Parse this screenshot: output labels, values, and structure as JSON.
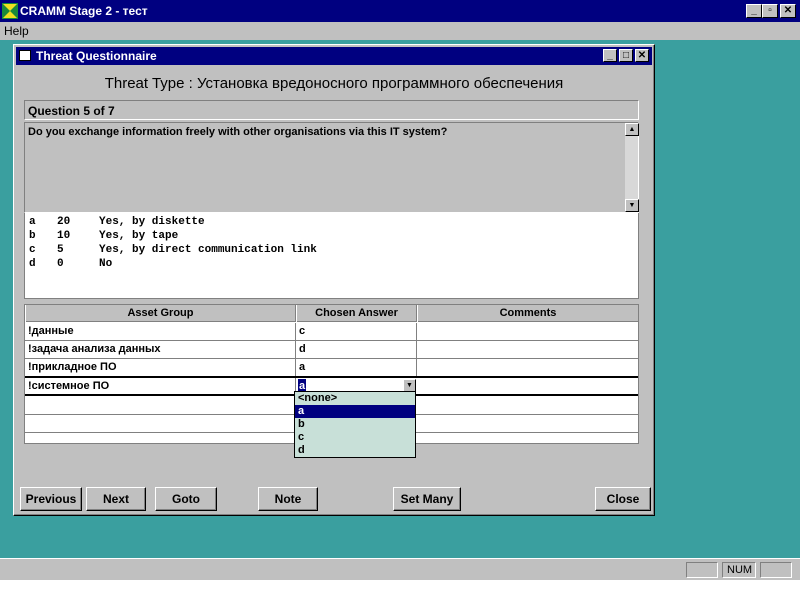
{
  "app": {
    "title": "CRAMM Stage 2 - тест",
    "menu": [
      "Help"
    ],
    "status": {
      "num": "NUM"
    }
  },
  "dialog": {
    "title": "Threat Questionnaire",
    "threat_type": "Threat Type : Установка вредоносного программного обеспечения",
    "question_header": "Question 5 of 7",
    "question_text": "Do you exchange information freely with other organisations via this IT system?",
    "answers": [
      {
        "letter": "a",
        "score": "20",
        "text": "Yes, by diskette"
      },
      {
        "letter": "b",
        "score": "10",
        "text": "Yes, by tape"
      },
      {
        "letter": "c",
        "score": "5",
        "text": "Yes, by direct communication link"
      },
      {
        "letter": "d",
        "score": "0",
        "text": "No"
      }
    ],
    "grid": {
      "columns": [
        "Asset Group",
        "Chosen Answer",
        "Comments"
      ],
      "rows": [
        {
          "group": "!данные",
          "answer": "c",
          "comment": ""
        },
        {
          "group": "!задача анализа данных",
          "answer": "d",
          "comment": ""
        },
        {
          "group": "!прикладное ПО",
          "answer": "a",
          "comment": ""
        },
        {
          "group": "!системное ПО",
          "answer": "a",
          "comment": ""
        }
      ]
    },
    "dropdown": {
      "options": [
        "<none>",
        "a",
        "b",
        "c",
        "d"
      ],
      "selected": "a"
    },
    "buttons": {
      "previous": "Previous",
      "next": "Next",
      "goto": "Goto",
      "note": "Note",
      "set_many": "Set Many",
      "close": "Close"
    }
  }
}
